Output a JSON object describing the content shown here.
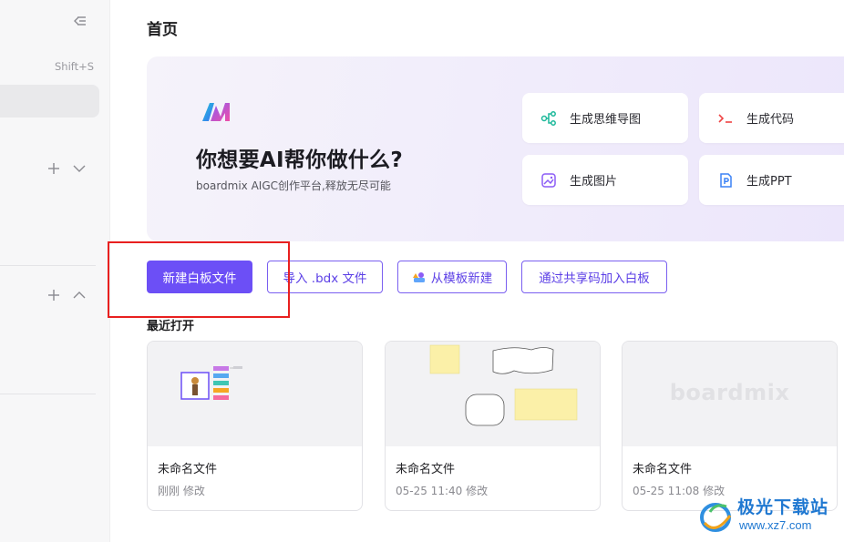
{
  "sidebar": {
    "shortcut": "Shift+S"
  },
  "page": {
    "title": "首页"
  },
  "hero": {
    "title": "你想要AI帮你做什么?",
    "subtitle": "boardmix AIGC创作平台,释放无尽可能",
    "actions": [
      {
        "label": "生成思维导图",
        "icon": "mindmap-icon",
        "color": "#1bb89a"
      },
      {
        "label": "生成代码",
        "icon": "code-icon",
        "color": "#ef4444"
      },
      {
        "label": "生成图片",
        "icon": "image-icon",
        "color": "#8b5cf6"
      },
      {
        "label": "生成PPT",
        "icon": "ppt-icon",
        "color": "#3b82f6"
      }
    ]
  },
  "toolbar": {
    "new_board": "新建白板文件",
    "import": "导入 .bdx 文件",
    "from_template": "从模板新建",
    "join_code": "通过共享码加入白板"
  },
  "recent": {
    "title": "最近打开",
    "files": [
      {
        "name": "未命名文件",
        "time": "刚刚 修改"
      },
      {
        "name": "未命名文件",
        "time": "05-25 11:40 修改"
      },
      {
        "name": "未命名文件",
        "time": "05-25 11:08 修改",
        "thumb_text": "boardmix"
      }
    ]
  },
  "watermark": {
    "title": "极光下载站",
    "url": "www.xz7.com"
  },
  "colors": {
    "accent": "#6c4ff6",
    "highlight": "#e8201f"
  }
}
